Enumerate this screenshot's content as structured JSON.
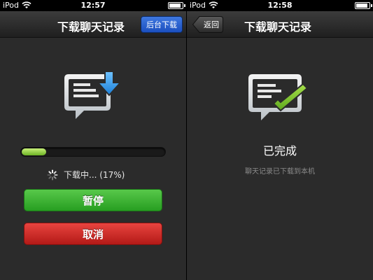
{
  "left": {
    "status": {
      "carrier": "iPod",
      "time": "12:57",
      "battery_level": 0.9
    },
    "nav": {
      "title": "下载聊天记录",
      "background_button": "后台下载"
    },
    "progress": {
      "value": 0.17
    },
    "status_text": "下载中... (17%)",
    "pause_button": "暂停",
    "cancel_button": "取消"
  },
  "right": {
    "status": {
      "carrier": "iPod",
      "time": "12:58",
      "battery_level": 0.9
    },
    "nav": {
      "title": "下载聊天记录",
      "back_button": "返回"
    },
    "done_title": "已完成",
    "done_subtitle": "聊天记录已下载到本机"
  },
  "icons": {
    "download": "chat-download-icon",
    "complete": "chat-complete-icon",
    "spinner": "spinner-icon",
    "wifi": "wifi-icon",
    "battery": "battery-icon"
  },
  "colors": {
    "accent_blue": "#2a62d6",
    "progress_green": "#8bd03e",
    "pause_green": "#35b02c",
    "cancel_red": "#cc2a26",
    "check_green": "#7cc52a"
  }
}
